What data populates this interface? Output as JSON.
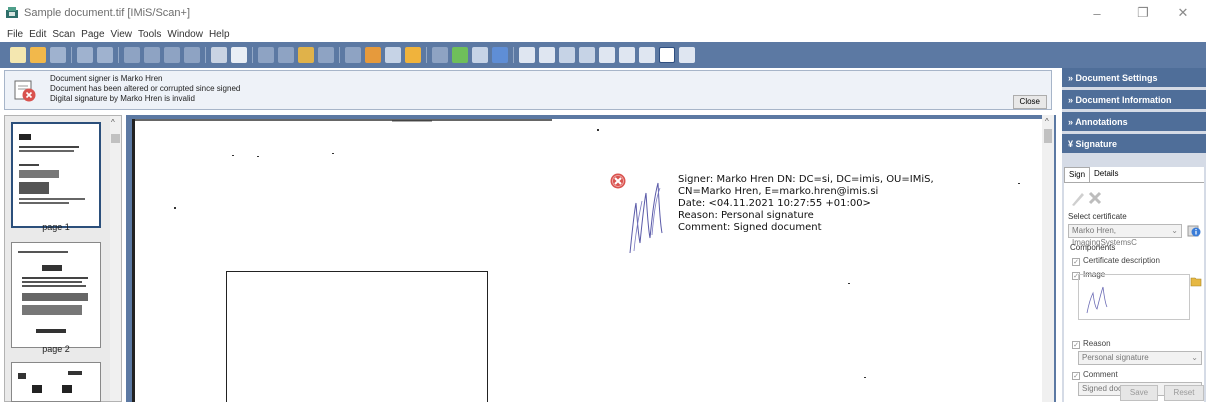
{
  "window": {
    "title": "Sample document.tif [IMiS/Scan+]",
    "minimize_glyph": "–",
    "maximize_glyph": "❐",
    "close_glyph": "✕"
  },
  "menu": [
    "File",
    "Edit",
    "Scan",
    "Page",
    "View",
    "Tools",
    "Window",
    "Help"
  ],
  "status": {
    "lines": [
      "Document signer is  Marko Hren",
      "Document has been altered or corrupted since signed",
      "Digital signature by Marko Hren is invalid"
    ],
    "close_label": "Close"
  },
  "thumbnails": [
    {
      "label": "page 1"
    },
    {
      "label": "page 2"
    }
  ],
  "signature_overlay": {
    "lines": [
      "Signer: Marko Hren DN: DC=si, DC=imis, OU=IMiS,",
      "CN=Marko Hren, E=marko.hren@imis.si",
      "Date: <04.11.2021 10:27:55 +01:00>",
      "Reason: Personal signature",
      "Comment: Signed document"
    ]
  },
  "right_panel": {
    "sections": [
      {
        "label": "Document Settings",
        "chevron": "»"
      },
      {
        "label": "Document Information",
        "chevron": "»"
      },
      {
        "label": "Annotations",
        "chevron": "»"
      },
      {
        "label": "Signature",
        "chevron": "¥"
      }
    ],
    "tabs": [
      "Sign",
      "Details"
    ],
    "select_certificate_label": "Select certificate",
    "certificate_value": "Marko Hren, ImagingSystemsC",
    "components_label": "Components",
    "certificate_description_label": "Certificate description",
    "image_label": "Image",
    "reason_label": "Reason",
    "reason_value": "Personal signature",
    "comment_label": "Comment",
    "comment_value": "Signed document",
    "save_label": "Save",
    "reset_label": "Reset"
  },
  "colors": {
    "toolbar": "#5c79a3",
    "panel_header": "#4f6e99",
    "error": "#d9534f"
  }
}
